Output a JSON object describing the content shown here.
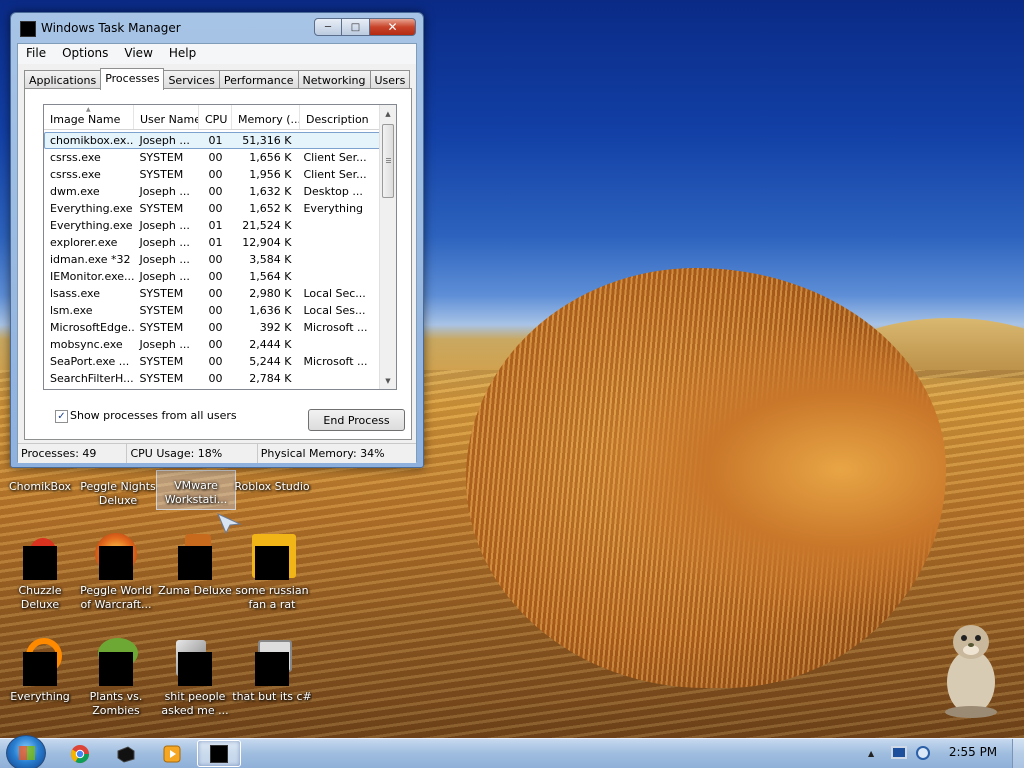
{
  "window": {
    "title": "Windows Task Manager",
    "menu": [
      "File",
      "Options",
      "View",
      "Help"
    ],
    "tabs": [
      {
        "label": "Applications",
        "active": false
      },
      {
        "label": "Processes",
        "active": true
      },
      {
        "label": "Services",
        "active": false
      },
      {
        "label": "Performance",
        "active": false
      },
      {
        "label": "Networking",
        "active": false
      },
      {
        "label": "Users",
        "active": false
      }
    ],
    "columns": [
      "Image Name",
      "User Name",
      "CPU",
      "Memory (...",
      "Description"
    ],
    "processes": [
      {
        "name": "chomikbox.ex...",
        "user": "Joseph ...",
        "cpu": "01",
        "memory": "51,316 K",
        "description": "",
        "selected": true
      },
      {
        "name": "csrss.exe",
        "user": "SYSTEM",
        "cpu": "00",
        "memory": "1,656 K",
        "description": "Client Ser..."
      },
      {
        "name": "csrss.exe",
        "user": "SYSTEM",
        "cpu": "00",
        "memory": "1,956 K",
        "description": "Client Ser..."
      },
      {
        "name": "dwm.exe",
        "user": "Joseph ...",
        "cpu": "00",
        "memory": "1,632 K",
        "description": "Desktop ..."
      },
      {
        "name": "Everything.exe",
        "user": "SYSTEM",
        "cpu": "00",
        "memory": "1,652 K",
        "description": "Everything"
      },
      {
        "name": "Everything.exe",
        "user": "Joseph ...",
        "cpu": "01",
        "memory": "21,524 K",
        "description": ""
      },
      {
        "name": "explorer.exe",
        "user": "Joseph ...",
        "cpu": "01",
        "memory": "12,904 K",
        "description": ""
      },
      {
        "name": "idman.exe *32",
        "user": "Joseph ...",
        "cpu": "00",
        "memory": "3,584 K",
        "description": ""
      },
      {
        "name": "IEMonitor.exe...",
        "user": "Joseph ...",
        "cpu": "00",
        "memory": "1,564 K",
        "description": ""
      },
      {
        "name": "lsass.exe",
        "user": "SYSTEM",
        "cpu": "00",
        "memory": "2,980 K",
        "description": "Local Sec..."
      },
      {
        "name": "lsm.exe",
        "user": "SYSTEM",
        "cpu": "00",
        "memory": "1,636 K",
        "description": "Local Ses..."
      },
      {
        "name": "MicrosoftEdge...",
        "user": "SYSTEM",
        "cpu": "00",
        "memory": "392 K",
        "description": "Microsoft ..."
      },
      {
        "name": "mobsync.exe",
        "user": "Joseph ...",
        "cpu": "00",
        "memory": "2,444 K",
        "description": ""
      },
      {
        "name": "SeaPort.exe ...",
        "user": "SYSTEM",
        "cpu": "00",
        "memory": "5,244 K",
        "description": "Microsoft ..."
      },
      {
        "name": "SearchFilterH...",
        "user": "SYSTEM",
        "cpu": "00",
        "memory": "2,784 K",
        "description": ""
      }
    ],
    "show_all_label": "Show processes from all users",
    "show_all_checked": true,
    "end_process_label": "End Process",
    "status": {
      "processes": "Processes: 49",
      "cpu": "CPU Usage: 18%",
      "memory": "Physical Memory: 34%"
    }
  },
  "desktop_icons": [
    {
      "label": "ChomikBox",
      "label2": ""
    },
    {
      "label": "Peggle Nights",
      "label2": "Deluxe"
    },
    {
      "label": "VMware",
      "label2": "Workstati..."
    },
    {
      "label": "Roblox Studio",
      "label2": ""
    },
    {
      "label": "Chuzzle",
      "label2": "Deluxe"
    },
    {
      "label": "Peggle World",
      "label2": "of Warcraft..."
    },
    {
      "label": "Zuma Deluxe",
      "label2": ""
    },
    {
      "label": "some russian",
      "label2": "fan a rat"
    },
    {
      "label": "Everything",
      "label2": ""
    },
    {
      "label": "Plants vs.",
      "label2": "Zombies"
    },
    {
      "label": "shit people",
      "label2": "asked me ..."
    },
    {
      "label": "that but its c#",
      "label2": ""
    }
  ],
  "taskbar": {
    "pinned": [
      "chrome-icon",
      "app-icon",
      "media-player-icon",
      "task-manager-icon"
    ],
    "clock": "2:55 PM"
  }
}
